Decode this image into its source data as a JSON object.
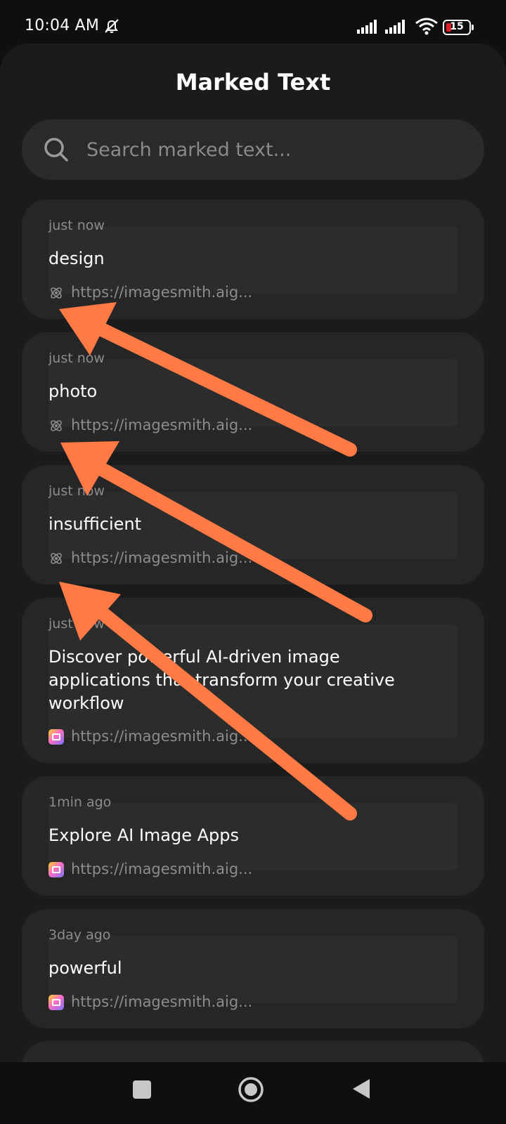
{
  "status_bar": {
    "time": "10:04 AM",
    "battery": "15",
    "icons": [
      "bell-off-icon",
      "signal-icon",
      "signal-icon",
      "wifi-icon",
      "battery-icon"
    ]
  },
  "header": {
    "title": "Marked Text"
  },
  "search": {
    "placeholder": "Search marked text..."
  },
  "cards": [
    {
      "time": "just now",
      "text": "design",
      "url": "https://imagesmith.aig...",
      "source_icon": "atom-icon"
    },
    {
      "time": "just now",
      "text": "photo",
      "url": "https://imagesmith.aig...",
      "source_icon": "atom-icon"
    },
    {
      "time": "just now",
      "text": "insufficient",
      "url": "https://imagesmith.aig...",
      "source_icon": "atom-icon"
    },
    {
      "time": "just now",
      "text": "Discover powerful AI-driven image applications that transform your creative workflow",
      "url": "https://imagesmith.aig...",
      "source_icon": "gradient-app-icon"
    },
    {
      "time": "1min ago",
      "text": "Explore AI Image Apps",
      "url": "https://imagesmith.aig...",
      "source_icon": "gradient-app-icon"
    },
    {
      "time": "3day ago",
      "text": "powerful",
      "url": "https://imagesmith.aig...",
      "source_icon": "gradient-app-icon"
    }
  ],
  "nav_bar": {
    "icons": [
      "recents-square-icon",
      "home-circle-icon",
      "back-triangle-icon"
    ]
  },
  "colors": {
    "background": "#0f0f0f",
    "sheet": "#1b1b1b",
    "card": "#262626",
    "annotation_arrow": "#ff7a45",
    "battery_low": "#e11d2b"
  }
}
